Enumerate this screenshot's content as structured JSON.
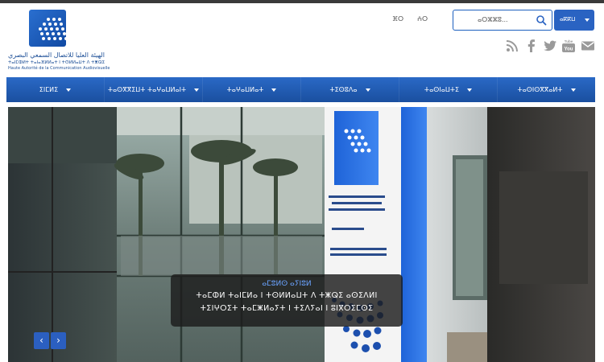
{
  "header": {
    "logo": {
      "arabic_name": "الهيئة العليا للاتصال السمعي البصري",
      "tifinagh_name": "ⵜⴰⵏⵎⵀⵍⵜ ⵜⴰⵏⴰⴼⵍⵍⴰⵜ ⵏ ⵜⵙⵍⵍⴰⵡⵜ ⴷ ⵜⵥⵕⵉ",
      "french_name": "Haute Autorité de la Communication Audiovisuelle"
    },
    "languages": [
      "ⴼⵔ",
      "ⵄⵔ"
    ],
    "search": {
      "placeholder": "ⴰⵔⵣⵣⵓ...",
      "button_label": "ⴰⴽⴽⵡ"
    },
    "social": [
      "rss-icon",
      "facebook-icon",
      "twitter-icon",
      "youtube-icon",
      "mail-icon"
    ]
  },
  "nav": {
    "items": [
      {
        "label": "ⵉⵏⵎⵍⵉ"
      },
      {
        "label": "ⵜⴰⵙⴳⴳⵉⵡⵜ ⵜⴰⵖⴰⵡⵍⴰⵏⵜ"
      },
      {
        "label": "ⵜⴰⵖⴰⵡⵍⴰⵜ"
      },
      {
        "label": "ⵜⵉⵙⵓⴷⴰ"
      },
      {
        "label": "ⵜⴰⵙⵏⴰⵡⵜⵉ"
      },
      {
        "label": "ⵜⴰⵙⵏⵙⴳⴳⴰⵍⵜ"
      }
    ]
  },
  "slider": {
    "caption_title": "ⴰⵎⵓⵍⵙ ⴰⵢⵏⵓⵍ",
    "caption_line1": "ⵜⴰⵎⵀⵍ ⵜⴰⵏⵎⵍⴰ ⵏ ⵜⵙⵍⵍⴰⵡⵜ ⴷ ⵜⵥⵕⵉ ⴰⵙⵉⴷⵍⵏ",
    "caption_line2": "ⵜⵉⵏⵖⵔⵉⵜ ⵜⴰⵎⵥⵍⴰⵢⵜ ⵏ ⵜⵉⴷⵢⴰⵏ ⵏ ⵓⵏⴳⵔⵉⵎⵙⵉ",
    "prev_label": "‹",
    "next_label": "›"
  },
  "colors": {
    "brand_blue": "#1f5bb8",
    "nav_blue": "#2a63c2",
    "caption_bg": "#1c1c1c"
  }
}
